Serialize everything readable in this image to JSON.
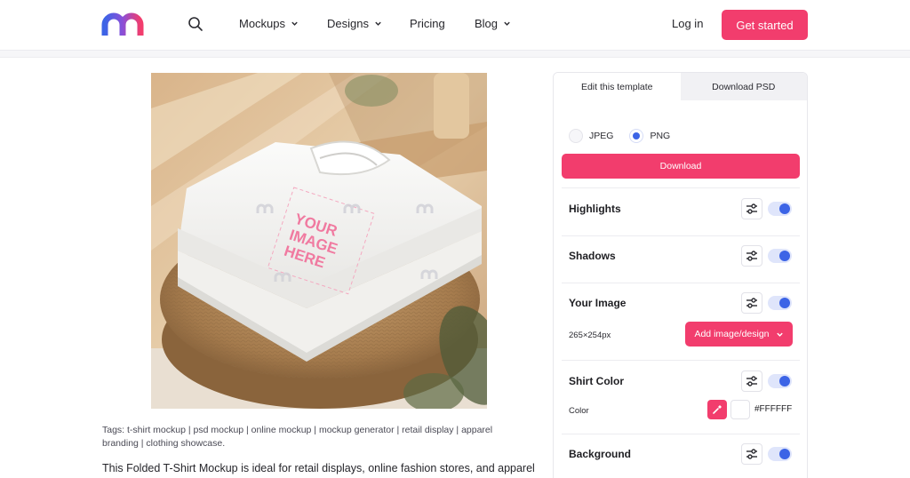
{
  "header": {
    "nav": [
      {
        "label": "Mockups",
        "has_dropdown": true
      },
      {
        "label": "Designs",
        "has_dropdown": true
      },
      {
        "label": "Pricing",
        "has_dropdown": false
      },
      {
        "label": "Blog",
        "has_dropdown": true
      }
    ],
    "login_label": "Log in",
    "cta_label": "Get started"
  },
  "preview": {
    "placeholder_line1": "YOUR",
    "placeholder_line2": "IMAGE",
    "placeholder_line3": "HERE"
  },
  "tags_text": "Tags: t-shirt mockup | psd mockup | online mockup | mockup generator | retail display | apparel branding | clothing showcase.",
  "description_text": "This Folded T-Shirt Mockup is ideal for retail displays, online fashion stores, and apparel",
  "panel": {
    "tabs": [
      {
        "label": "Edit this template",
        "active": true
      },
      {
        "label": "Download PSD",
        "active": false
      }
    ],
    "formats": [
      {
        "label": "JPEG",
        "selected": false
      },
      {
        "label": "PNG",
        "selected": true
      }
    ],
    "download_label": "Download",
    "sections": {
      "highlights": {
        "title": "Highlights",
        "enabled": true
      },
      "shadows": {
        "title": "Shadows",
        "enabled": true
      },
      "your_image": {
        "title": "Your Image",
        "enabled": true,
        "size_label": "265×254px",
        "add_label": "Add image/design"
      },
      "shirt_color": {
        "title": "Shirt Color",
        "enabled": true,
        "color_label": "Color",
        "hex": "#FFFFFF"
      },
      "background": {
        "title": "Background",
        "enabled": true
      }
    }
  },
  "colors": {
    "accent": "#f23d6d",
    "toggle_blue": "#3c64e6",
    "logo_blue": "#3c64e6",
    "logo_pink": "#f23d6d",
    "logo_purple": "#8a4fd8"
  }
}
